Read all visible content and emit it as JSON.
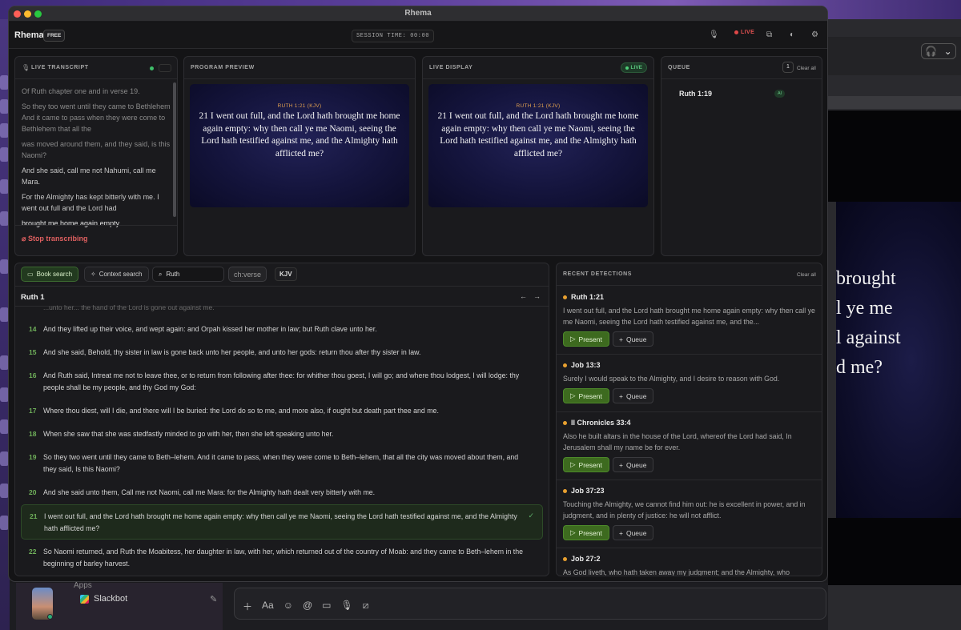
{
  "window": {
    "title": "Rhema"
  },
  "appbar": {
    "brand": "Rhema",
    "plan": "FREE",
    "session": "SESSION TIME: 00:00",
    "live": "LIVE"
  },
  "transcript": {
    "title": "LIVE TRANSCRIPT",
    "lines": [
      "Of Ruth chapter one and in verse 19.",
      "So they too went until they came to Bethlehem And it came to pass when they were come to Bethlehem that all the",
      "was moved around them, and they said, is this Naomi?",
      "And she said, call me not Nahumi, call me Mara.",
      "For the Almighty has kept bitterly with me. I went out full and the Lord had",
      "brought me home again empty."
    ],
    "stop": "Stop transcribing"
  },
  "preview": {
    "title": "PROGRAM PREVIEW",
    "ref": "RUTH 1:21 (KJV)",
    "text": "21 I went out full, and the Lord hath brought me home again empty: why then call ye me Naomi, seeing the Lord hath testified against me, and the Almighty hath afflicted me?"
  },
  "display": {
    "title": "LIVE DISPLAY",
    "badge": "LIVE",
    "ref": "RUTH 1:21 (KJV)",
    "text": "21 I went out full, and the Lord hath brought me home again empty: why then call ye me Naomi, seeing the Lord hath testified against me, and the Almighty hath afflicted me?"
  },
  "queue": {
    "title": "QUEUE",
    "count": "1",
    "clear": "Clear all",
    "items": [
      {
        "ref": "Ruth 1:19",
        "tag": "AI"
      }
    ]
  },
  "search": {
    "book_tab": "Book search",
    "context_tab": "Context search",
    "query": "Ruth",
    "chv_placeholder": "ch:verse",
    "version": "KJV",
    "chapter": "Ruth 1",
    "cut_line": "...unto her... the hand of the Lord is gone out against me.",
    "verses": [
      {
        "n": "14",
        "t": "And they lifted up their voice, and wept again: and Orpah kissed her mother in law; but Ruth clave unto her."
      },
      {
        "n": "15",
        "t": "And she said, Behold, thy sister in law is gone back unto her people, and unto her gods: return thou after thy sister in law."
      },
      {
        "n": "16",
        "t": "And Ruth said, Intreat me not to leave thee, or to return from following after thee: for whither thou goest, I will go; and where thou lodgest, I will lodge: thy people shall be my people, and thy God my God:"
      },
      {
        "n": "17",
        "t": "Where thou diest, will I die, and there will I be buried: the Lord do so to me, and more also, if ought but death part thee and me."
      },
      {
        "n": "18",
        "t": "When she saw that she was stedfastly minded to go with her, then she left speaking unto her."
      },
      {
        "n": "19",
        "t": "So they two went until they came to Beth–lehem. And it came to pass, when they were come to Beth–lehem, that all the city was moved about them, and they said, Is this Naomi?"
      },
      {
        "n": "20",
        "t": "And she said unto them, Call me not Naomi, call me Mara: for the Almighty hath dealt very bitterly with me."
      },
      {
        "n": "21",
        "t": "I went out full, and the Lord hath brought me home again empty: why then call ye me Naomi, seeing the Lord hath testified against me, and the Almighty hath afflicted me?"
      },
      {
        "n": "22",
        "t": "So Naomi returned, and Ruth the Moabitess, her daughter in law, with her, which returned out of the country of Moab: and they came to Beth–lehem in the beginning of barley harvest."
      }
    ]
  },
  "detections": {
    "title": "RECENT DETECTIONS",
    "clear": "Clear all",
    "present": "Present",
    "queue": "Queue",
    "items": [
      {
        "ref": "Ruth 1:21",
        "t": "I went out full, and the Lord hath brought me home again empty: why then call ye me Naomi, seeing the Lord hath testified against me, and the..."
      },
      {
        "ref": "Job 13:3",
        "t": "Surely I would speak to the Almighty, and I desire to reason with God."
      },
      {
        "ref": "II Chronicles 33:4",
        "t": "Also he built altars in the house of the Lord, whereof the Lord had said, In Jerusalem shall my name be for ever."
      },
      {
        "ref": "Job 37:23",
        "t": "Touching the Almighty, we cannot find him out: he is excellent in power, and in judgment, and in plenty of justice: he will not afflict."
      },
      {
        "ref": "Job 27:2",
        "t": "As God liveth, who hath taken away my judgment; and the Almighty, who"
      }
    ]
  },
  "background": {
    "big_text": [
      "brought",
      "l ye me",
      "l against",
      "d me?"
    ],
    "apps": "Apps",
    "slackbot": "Slackbot"
  }
}
